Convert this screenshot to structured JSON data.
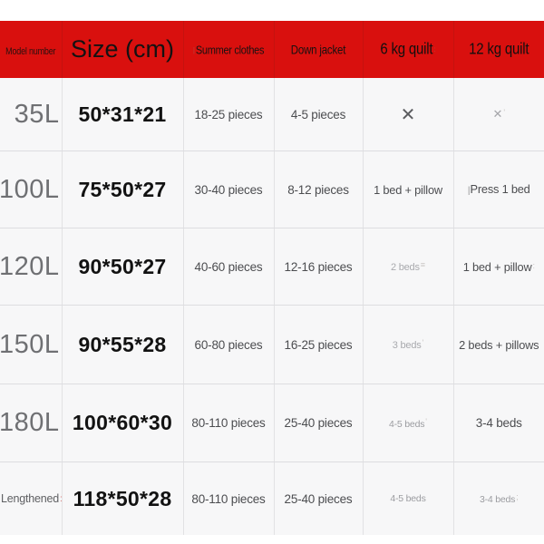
{
  "table": {
    "headers": [
      {
        "id": "model-number",
        "label": "Model number"
      },
      {
        "id": "size-cm",
        "label": "Size (cm)"
      },
      {
        "id": "summer-clothes",
        "label": "Summer clothes"
      },
      {
        "id": "down-jacket",
        "label": "Down jacket"
      },
      {
        "id": "quilt-6kg",
        "label": "6 kg quilt"
      },
      {
        "id": "quilt-12kg",
        "label": "12 kg quilt"
      }
    ],
    "header_accent_color": "#d9100e",
    "rows": [
      {
        "model": "35L",
        "size": "50*31*21",
        "summer": "18-25 pieces",
        "down": "4-5 pieces",
        "quilt6": "✕",
        "quilt12": "✕"
      },
      {
        "model": "100L",
        "size": "75*50*27",
        "summer": "30-40 pieces",
        "down": "8-12 pieces",
        "quilt6": "1 bed + pillow",
        "quilt12": "Press 1 bed"
      },
      {
        "model": "120L",
        "size": "90*50*27",
        "summer": "40-60 pieces",
        "down": "12-16 pieces",
        "quilt6": "2 beds",
        "quilt12": "1 bed + pillow"
      },
      {
        "model": "150L",
        "size": "90*55*28",
        "summer": "60-80 pieces",
        "down": "16-25 pieces",
        "quilt6": "3 beds",
        "quilt12": "2 beds + pillows"
      },
      {
        "model": "180L",
        "size": "100*60*30",
        "summer": "80-110 pieces",
        "down": "25-40 pieces",
        "quilt6": "4-5 beds",
        "quilt12": "3-4 beds"
      },
      {
        "model": "Lengthened",
        "size": "118*50*28",
        "summer": "80-110 pieces",
        "down": "25-40 pieces",
        "quilt6": "4-5 beds",
        "quilt12": "3-4 beds"
      }
    ]
  }
}
